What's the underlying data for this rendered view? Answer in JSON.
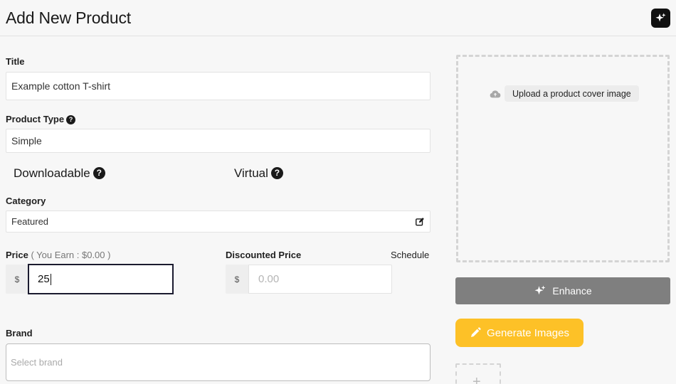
{
  "header": {
    "title": "Add New Product"
  },
  "form": {
    "title": {
      "label": "Title",
      "value": "Example cotton T-shirt"
    },
    "product_type": {
      "label": "Product Type",
      "value": "Simple"
    },
    "options": {
      "downloadable": "Downloadable",
      "virtual": "Virtual"
    },
    "category": {
      "label": "Category",
      "value": "Featured"
    },
    "price": {
      "label": "Price",
      "earn_note": "( You Earn : $0.00 )",
      "currency": "$",
      "value": "25"
    },
    "discounted_price": {
      "label": "Discounted Price",
      "currency": "$",
      "placeholder": "0.00",
      "schedule": "Schedule"
    },
    "brand": {
      "label": "Brand",
      "placeholder": "Select brand"
    }
  },
  "media": {
    "upload_label": "Upload a product cover image",
    "enhance_label": "Enhance",
    "generate_label": "Generate Images",
    "add_symbol": "+"
  },
  "colors": {
    "accent": "#fdc127",
    "enhance": "#7f7f7f",
    "dark": "#111111"
  },
  "help_symbol": "?"
}
